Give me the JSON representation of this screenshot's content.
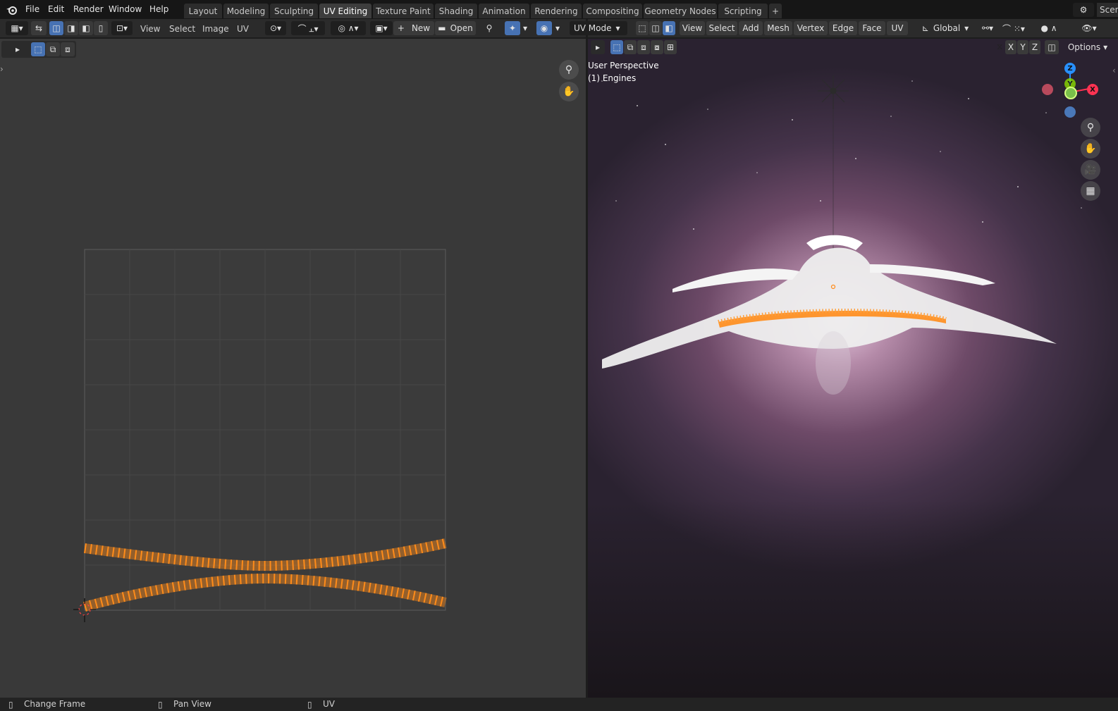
{
  "menus": [
    "File",
    "Edit",
    "Render",
    "Window",
    "Help"
  ],
  "workspaces": [
    "Layout",
    "Modeling",
    "Sculpting",
    "UV Editing",
    "Texture Paint",
    "Shading",
    "Animation",
    "Rendering",
    "Compositing",
    "Geometry Nodes",
    "Scripting"
  ],
  "active_workspace": "UV Editing",
  "add_tab": "+",
  "scene_label": "Scen",
  "uv_header": {
    "view": "View",
    "select": "Select",
    "image": "Image",
    "uv": "UV",
    "new": "New",
    "open": "Open",
    "new_plus": "+"
  },
  "viewport_header": {
    "mode": "UV Mode",
    "view": "View",
    "select": "Select",
    "add": "Add",
    "mesh": "Mesh",
    "vertex": "Vertex",
    "edge": "Edge",
    "face": "Face",
    "uv": "UV",
    "orientation": "Global",
    "options": "Options",
    "axis_x": "X",
    "axis_y": "Y",
    "axis_z": "Z"
  },
  "viewport_info": {
    "perspective": "User Perspective",
    "object": "(1) Engines"
  },
  "gizmo": {
    "x": "X",
    "y": "Y",
    "z": "Z"
  },
  "status": {
    "left": "Change Frame",
    "middle": "Pan View",
    "right": "UV"
  },
  "colors": {
    "accent": "#4772b3",
    "selection": "#ff8c1a",
    "axis_x": "#ff3352",
    "axis_y": "#8bdc00",
    "axis_z": "#2890ff"
  }
}
